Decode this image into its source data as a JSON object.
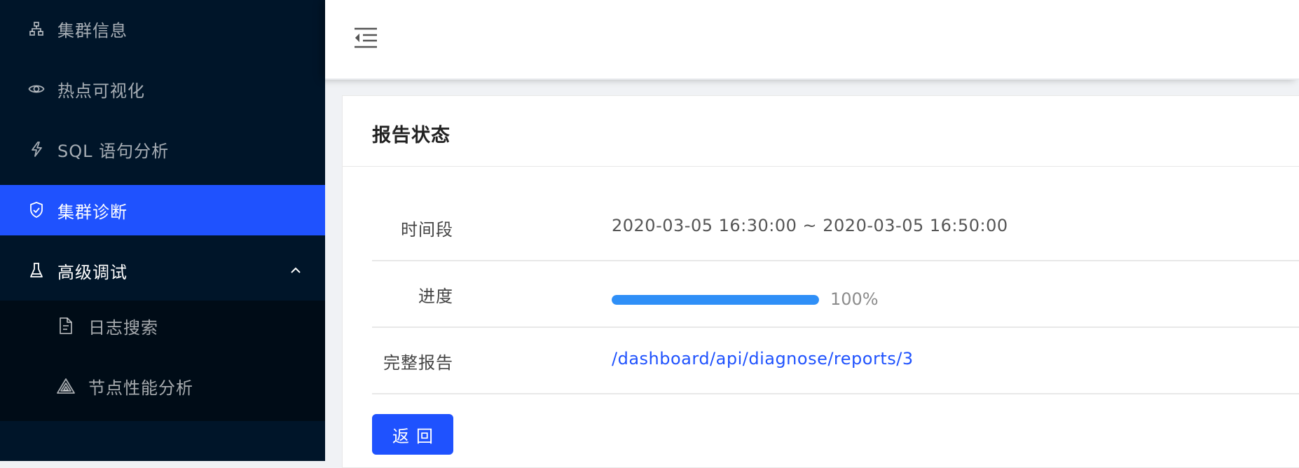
{
  "sidebar": {
    "items": [
      {
        "label": "集群信息",
        "icon": "cluster-icon"
      },
      {
        "label": "热点可视化",
        "icon": "eye-icon"
      },
      {
        "label": "SQL 语句分析",
        "icon": "thunderbolt-icon"
      },
      {
        "label": "集群诊断",
        "icon": "safety-shield-icon",
        "active": true
      },
      {
        "label": "高级调试",
        "icon": "experiment-flask-icon",
        "expanded": true
      }
    ],
    "submenu": [
      {
        "label": "日志搜索",
        "icon": "file-text-icon"
      },
      {
        "label": "节点性能分析",
        "icon": "triangle-layers-icon"
      }
    ]
  },
  "header": {
    "toggle_icon": "menu-fold-icon"
  },
  "report": {
    "title": "报告状态",
    "time_label": "时间段",
    "time_value": "2020-03-05 16:30:00 ~ 2020-03-05 16:50:00",
    "progress_label": "进度",
    "progress_percent": 100,
    "progress_text": "100%",
    "full_report_label": "完整报告",
    "full_report_link": "/dashboard/api/diagnose/reports/3",
    "back_label": "返回"
  },
  "colors": {
    "sidebar_bg": "#001529",
    "submenu_bg": "#000c17",
    "active_bg": "#1f52fe",
    "progress": "#2f8ff7",
    "link": "#1f52fe"
  }
}
